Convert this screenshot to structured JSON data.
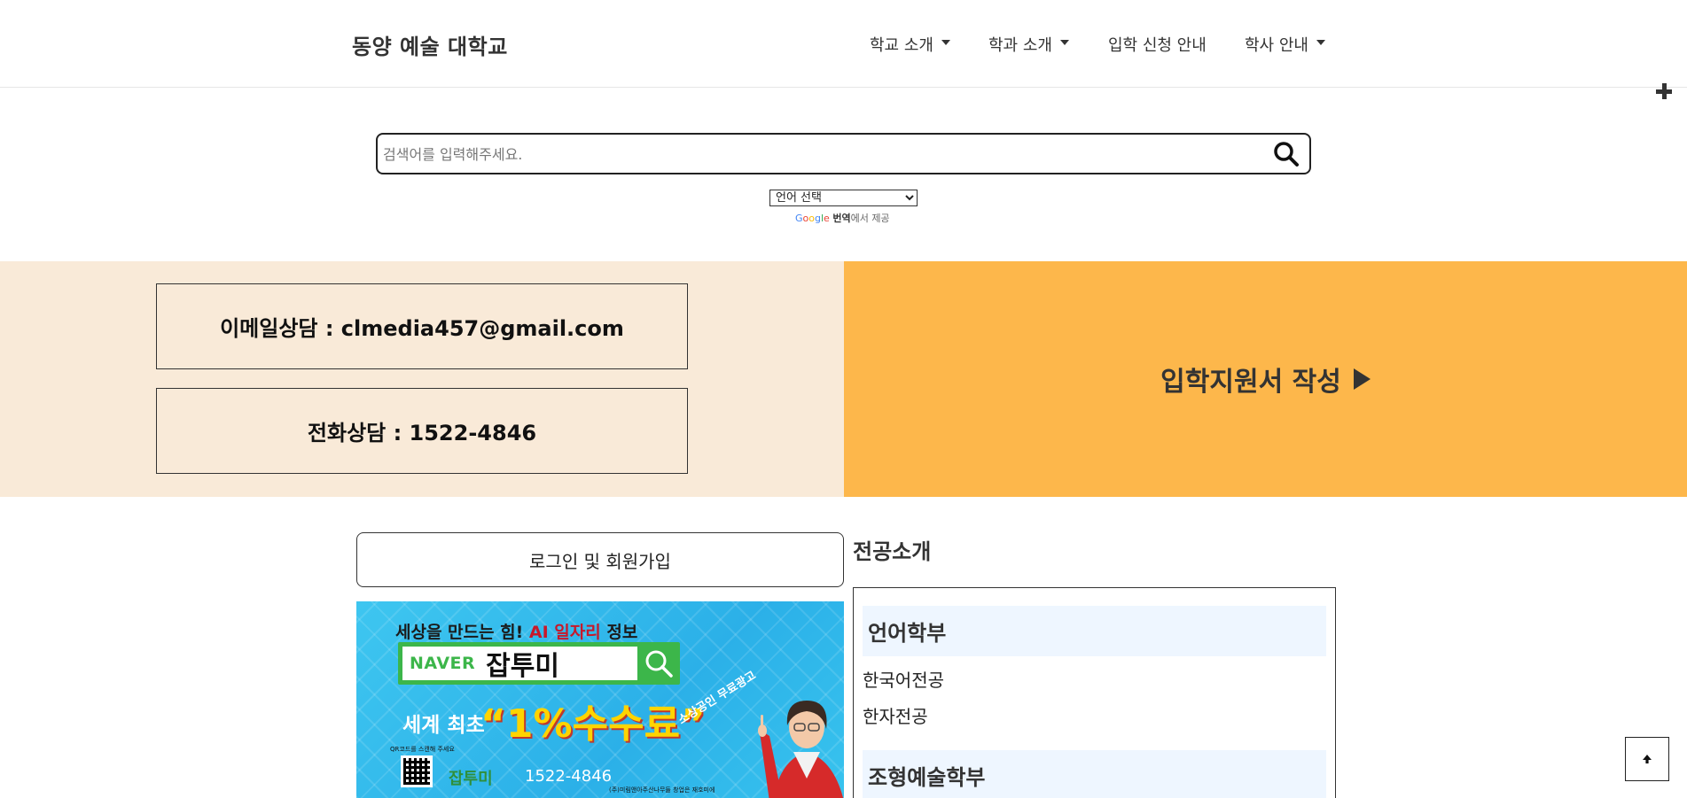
{
  "header": {
    "logo": "동양 예술 대학교",
    "nav": [
      {
        "label": "학교 소개",
        "dropdown": true
      },
      {
        "label": "학과 소개",
        "dropdown": true
      },
      {
        "label": "입학 신청 안내",
        "dropdown": false
      },
      {
        "label": "학사 안내",
        "dropdown": true
      }
    ]
  },
  "search": {
    "placeholder": "검색어를 입력해주세요."
  },
  "translate": {
    "selected_language": "언어 선택",
    "google": "Google",
    "translate_word": "번역",
    "suffix": "에서 제공"
  },
  "contact": {
    "email": "이메일상담 : clmedia457@gmail.com",
    "phone": "전화상담 : 1522-4846"
  },
  "apply": {
    "label": "입학지원서 작성"
  },
  "login": {
    "label": "로그인 및 회원가입"
  },
  "ad": {
    "top_text": "세상을 만드는 힘!",
    "top_ai": "AI 일자리",
    "top_info": "정보",
    "naver": "NAVER",
    "brand": "잡투미",
    "world": "세계 최초",
    "fee": "“1%수수료”",
    "free": "소상공인 무료광고",
    "qr_label": "QR코드를 스캔해 주세요",
    "logo": "잡투미",
    "phone": "1522-4846",
    "company": "(주)미림앤아주산나무들 창업은 재호미에"
  },
  "majors": {
    "title": "전공소개",
    "departments": [
      {
        "name": "언어학부",
        "majors": [
          "한국어전공",
          "한자전공"
        ]
      },
      {
        "name": "조형예술학부",
        "majors": []
      }
    ]
  },
  "colors": {
    "banner_left": "#f9ead8",
    "banner_right": "#fdb74b",
    "dept_header": "#eef6ff"
  }
}
